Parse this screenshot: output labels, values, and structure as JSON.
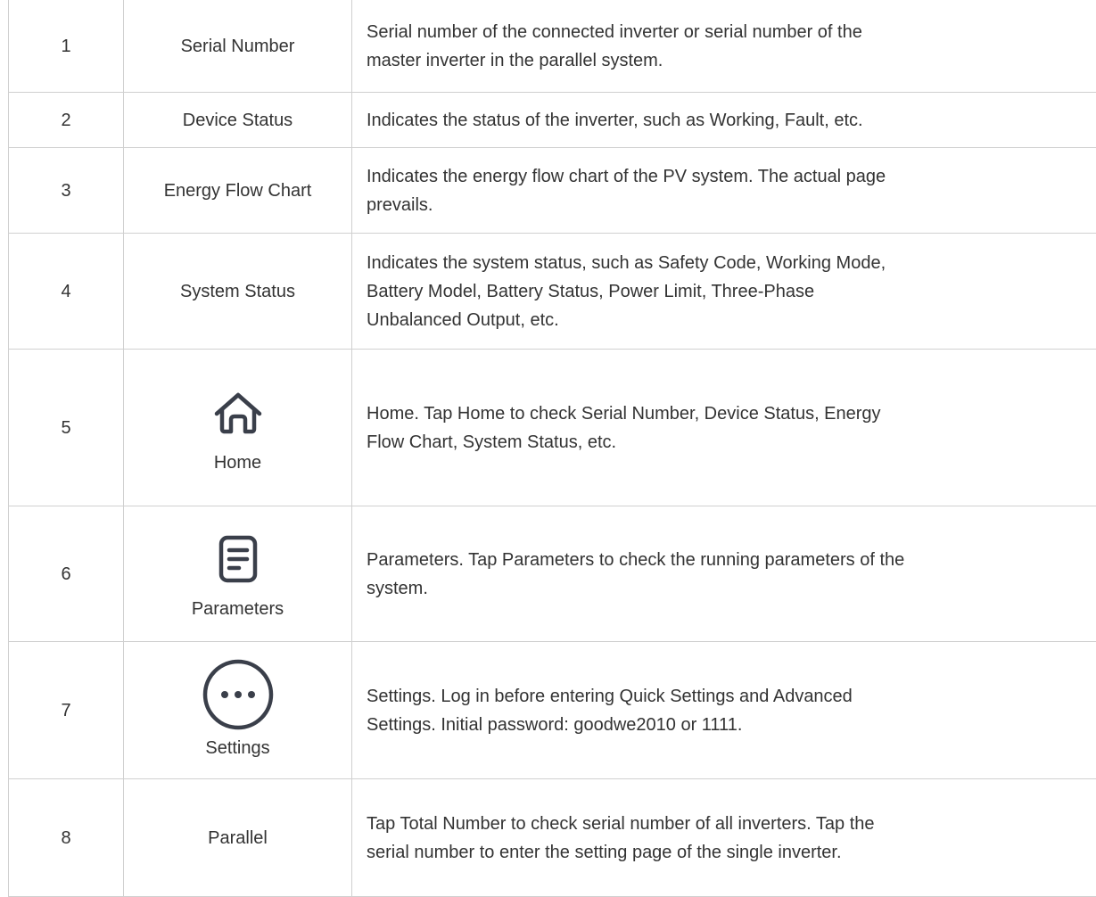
{
  "rows": [
    {
      "no": "1",
      "name": "Serial Number",
      "desc_lines": [
        "Serial number of the connected inverter or serial number of the",
        "master inverter in the parallel system."
      ]
    },
    {
      "no": "2",
      "name": "Device Status",
      "desc_lines": [
        "Indicates the status of the inverter, such as Working, Fault, etc."
      ]
    },
    {
      "no": "3",
      "name": "Energy Flow Chart",
      "desc_lines": [
        "Indicates the energy flow chart of the PV system. The actual page",
        "prevails."
      ]
    },
    {
      "no": "4",
      "name": "System Status",
      "desc_lines": [
        "Indicates the system status, such as Safety Code, Working Mode,",
        "Battery Model, Battery Status, Power Limit, Three-Phase",
        "Unbalanced Output, etc."
      ]
    },
    {
      "no": "5",
      "icon": "home-icon",
      "name": "Home",
      "desc_lines": [
        "Home. Tap Home to check Serial Number, Device Status, Energy",
        "Flow Chart, System Status, etc."
      ]
    },
    {
      "no": "6",
      "icon": "document-icon",
      "name": "Parameters",
      "desc_lines": [
        "Parameters. Tap Parameters to check the running parameters of the",
        "system."
      ]
    },
    {
      "no": "7",
      "icon": "more-circle-icon",
      "name": "Settings",
      "desc_lines": [
        "Settings. Log in before entering Quick Settings and Advanced",
        "Settings. Initial password: goodwe2010 or 1111."
      ]
    },
    {
      "no": "8",
      "name": "Parallel",
      "desc_lines": [
        "Tap Total Number to check serial number of all inverters. Tap the",
        "serial number to enter the setting page of the single inverter."
      ]
    }
  ],
  "colors": {
    "border": "#d0d0d0",
    "text": "#333333",
    "icon_stroke": "#3a3f4a"
  }
}
